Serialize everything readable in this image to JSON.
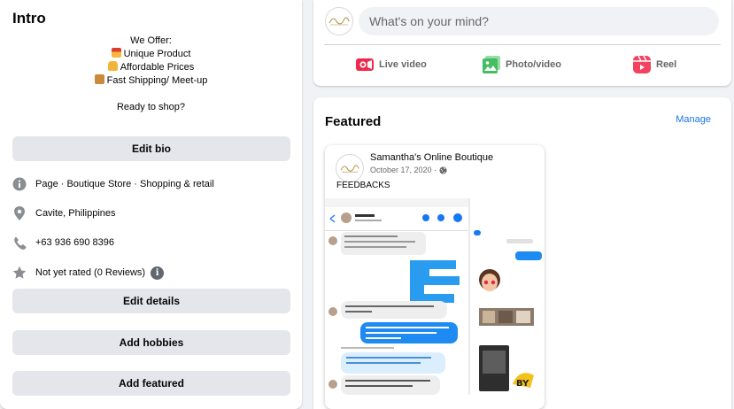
{
  "intro": {
    "title": "Intro",
    "bio": {
      "heading": "We Offer:",
      "items": [
        "Unique Product",
        "Affordable Prices",
        "Fast Shipping/ Meet-up"
      ],
      "closing": "Ready to shop?"
    },
    "edit_bio_label": "Edit bio",
    "details": [
      {
        "icon": "info-icon",
        "text": "Page · Boutique Store · Shopping & retail"
      },
      {
        "icon": "location-pin-icon",
        "text": "Cavite, Philippines"
      },
      {
        "icon": "phone-icon",
        "text": "+63 936 690 8396"
      },
      {
        "icon": "star-icon",
        "text": "Not yet rated (0 Reviews)"
      }
    ],
    "edit_details_label": "Edit details",
    "add_hobbies_label": "Add hobbies",
    "add_featured_label": "Add featured"
  },
  "composer": {
    "placeholder": "What's on your mind?",
    "actions": [
      {
        "icon": "live-video-icon",
        "label": "Live video",
        "color": "#f02849"
      },
      {
        "icon": "photo-video-icon",
        "label": "Photo/video",
        "color": "#45bd62"
      },
      {
        "icon": "reel-icon",
        "label": "Reel",
        "color": "#f3425f"
      }
    ]
  },
  "featured": {
    "title": "Featured",
    "manage_label": "Manage",
    "post": {
      "page_name": "Samantha's Online Boutique",
      "date": "October 17, 2020 ·",
      "text": "FEEDBACKS"
    }
  },
  "colors": {
    "accent": "#1b74e4",
    "button_bg": "#e4e6eb",
    "page_bg": "#f0f2f5"
  }
}
